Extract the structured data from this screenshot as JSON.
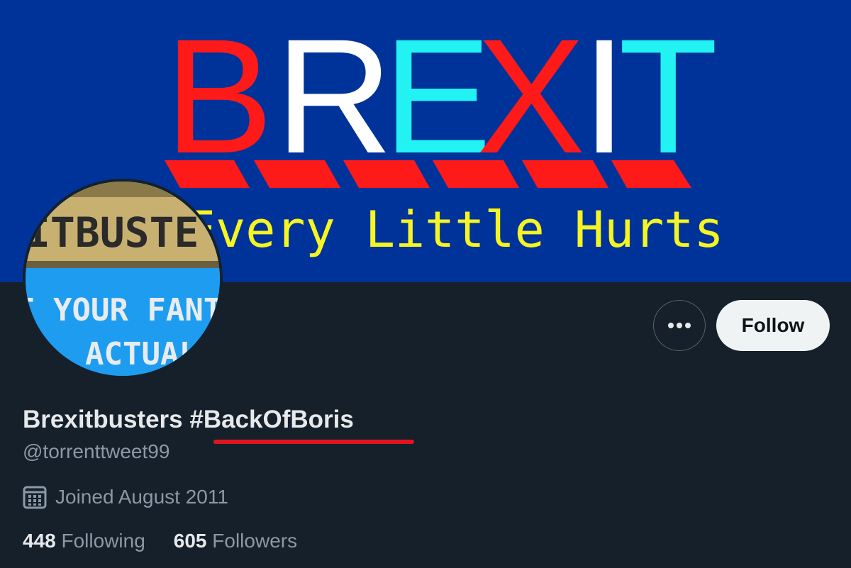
{
  "banner": {
    "word_letters": [
      "B",
      "R",
      "E",
      "X",
      "I",
      "T"
    ],
    "letter_colors": [
      "#ff1a1a",
      "#ff1a1a",
      "#ffffff",
      "#22f2f2",
      "#ff1a1a",
      "#ffffff",
      "#22f2f2"
    ],
    "tagline": "Every Little Hurts",
    "colors": {
      "background": "#003399",
      "tagline": "#f5f522",
      "stripe": "#ff1a1a"
    }
  },
  "avatar": {
    "line1": "ITBUSTE",
    "line2": "T YOUR FANTA",
    "line3": "ACTUAL"
  },
  "actions": {
    "more_icon": "more-icon",
    "follow_label": "Follow"
  },
  "profile": {
    "display_name": "Brexitbusters #BackOfBoris",
    "handle": "@torrenttweet99",
    "joined_icon": "calendar-icon",
    "joined_text": "Joined August 2011",
    "following_count": "448",
    "following_label": "Following",
    "followers_count": "605",
    "followers_label": "Followers"
  },
  "colors": {
    "page_background": "#15202b",
    "text_primary": "#e7e9ea",
    "text_secondary": "#8b98a5",
    "underline": "#e0141f"
  }
}
